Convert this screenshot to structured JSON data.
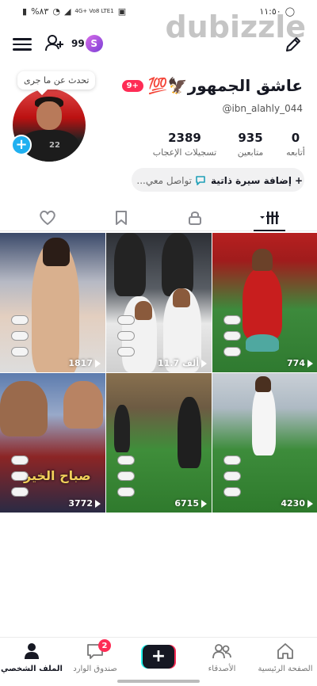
{
  "status_bar": {
    "time": "١١:٥٠",
    "battery": "%٨٣",
    "network": "4G+ Vo8 LTE1"
  },
  "watermark": "dubizzle",
  "top_nav": {
    "points": "99",
    "coin_letter": "S"
  },
  "profile": {
    "bubble_text": "تحدث عن ما جرى",
    "name": "عاشق الجمهور🦅💯",
    "notification_pill": "9+",
    "username": "@ibn_alahly_044",
    "stats": [
      {
        "value": "0",
        "label": "أتابعه"
      },
      {
        "value": "935",
        "label": "متابعين"
      },
      {
        "value": "2389",
        "label": "تسجيلات الإعجاب"
      }
    ],
    "bio_add_label": "إضافة سيرة ذاتية",
    "contact_label": "تواصل معي..."
  },
  "videos": [
    {
      "views": "1817"
    },
    {
      "views": "11.7 ألف"
    },
    {
      "views": "774"
    },
    {
      "views": "3772",
      "caption": "صباح الخير"
    },
    {
      "views": "6715"
    },
    {
      "views": "4230"
    }
  ],
  "bottom_nav": {
    "items": [
      {
        "label": "الصفحة الرئيسية",
        "icon": "home-icon"
      },
      {
        "label": "الأصدقاء",
        "icon": "friends-icon"
      },
      {
        "label": "",
        "icon": "create-icon"
      },
      {
        "label": "صندوق الوارد",
        "icon": "inbox-icon",
        "badge": "2"
      },
      {
        "label": "الملف الشخصي",
        "icon": "profile-icon"
      }
    ]
  },
  "colors": {
    "accent": "#fe2c55",
    "cyan": "#25f4ee",
    "text": "#161823",
    "avatar_plus": "#20b0f0"
  }
}
